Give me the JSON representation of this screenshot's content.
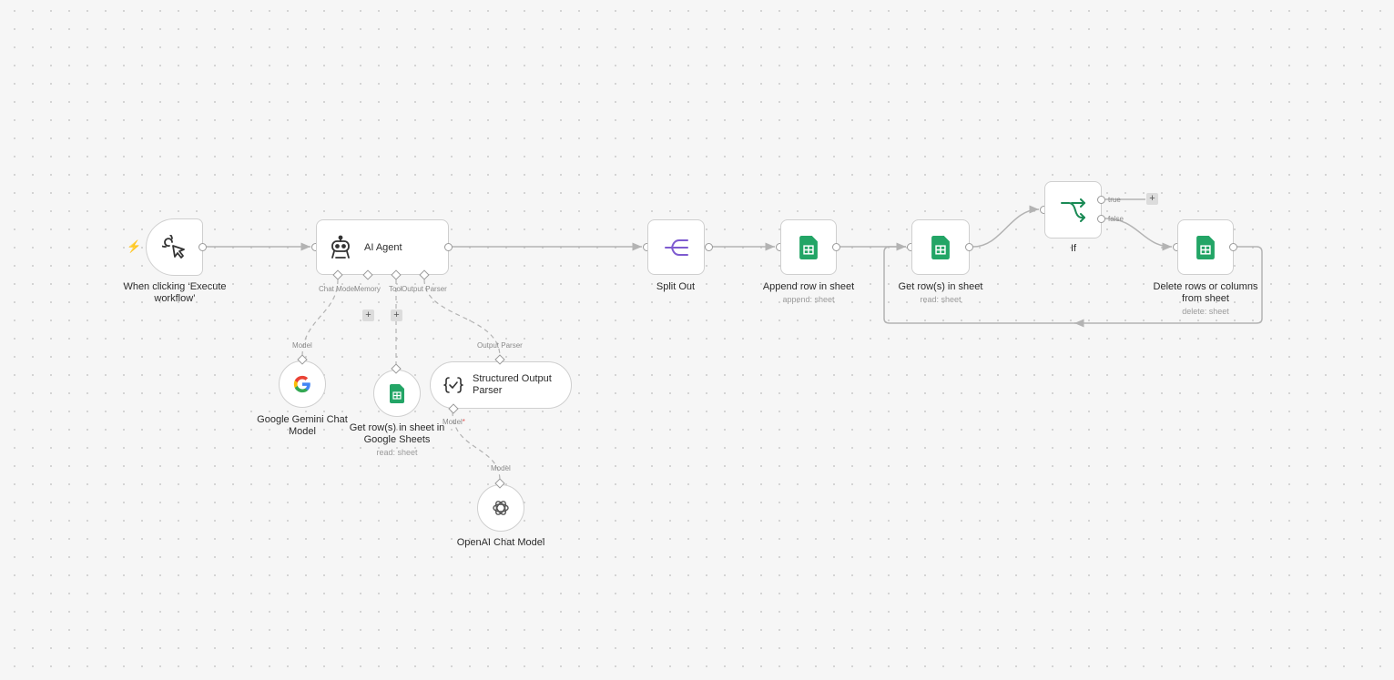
{
  "nodes": {
    "trigger": {
      "label": "When clicking ‘Execute workflow’",
      "icon": "cursor-click-icon"
    },
    "agent": {
      "label": "AI Agent",
      "icon": "robot-icon",
      "slots": {
        "chat_model": "Chat Model",
        "memory": "Memory",
        "tool": "Tool",
        "output_parser": "Output Parser"
      }
    },
    "gemini": {
      "label": "Google Gemini Chat Model",
      "slot": "Model",
      "icon": "google-icon"
    },
    "sheets_tool": {
      "label": "Get row(s) in sheet in Google Sheets",
      "sub": "read: sheet",
      "icon": "google-sheets-icon"
    },
    "parser": {
      "label": "Structured Output Parser",
      "slot": "Output Parser",
      "model_slot": "Model",
      "icon": "braces-check-icon"
    },
    "openai": {
      "label": "OpenAI Chat Model",
      "slot": "Model",
      "icon": "openai-icon"
    },
    "split": {
      "label": "Split Out",
      "icon": "split-icon"
    },
    "append": {
      "label": "Append row in sheet",
      "sub": "append: sheet",
      "icon": "google-sheets-icon"
    },
    "getrows": {
      "label": "Get row(s) in sheet",
      "sub": "read: sheet",
      "icon": "google-sheets-icon"
    },
    "if": {
      "label": "If",
      "true_label": "true",
      "false_label": "false",
      "icon": "if-branch-icon"
    },
    "delete": {
      "label": "Delete rows or columns from sheet",
      "sub": "delete: sheet",
      "icon": "google-sheets-icon"
    }
  },
  "plus_symbol": "+",
  "required_marker": "*",
  "trigger_icon": "lightning-bolt-icon",
  "colors": {
    "sheets_green": "#23a566",
    "split_purple": "#7e5bd0",
    "if_green": "#1a8a55",
    "trigger_bolt": "#f26e56",
    "edge": "#b3b3b3"
  }
}
